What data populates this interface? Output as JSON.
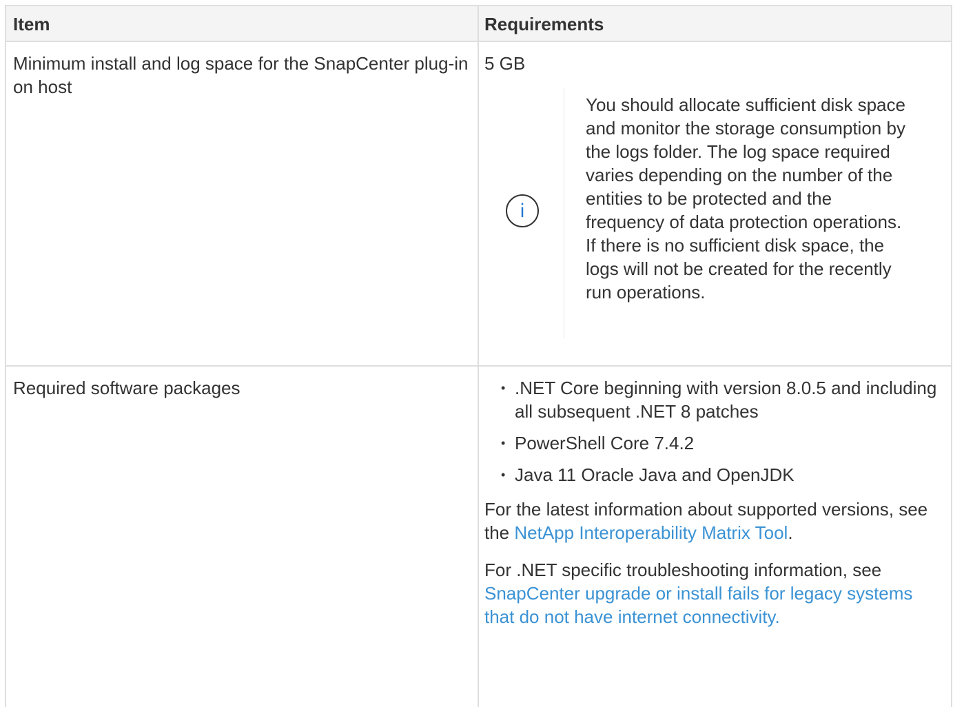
{
  "table": {
    "headers": [
      "Item",
      "Requirements"
    ],
    "rows": [
      {
        "item": "Minimum install and log space for the SnapCenter plug-in on host",
        "value": "5 GB",
        "note": {
          "icon": "info-icon",
          "text": "You should allocate sufficient disk space and monitor the storage consumption by the logs folder. The log space required varies depending on the number of the entities to be protected and the frequency of data protection operations. If there is no sufficient disk space, the logs will not be created for the recently run operations."
        }
      },
      {
        "item": "Required software packages",
        "packages": [
          ".NET Core beginning with version 8.0.5 and including all subsequent .NET 8 patches",
          "PowerShell Core 7.4.2",
          "Java 11 Oracle Java and OpenJDK"
        ],
        "para1_prefix": "For the latest information about supported versions, see the ",
        "para1_link": "NetApp Interoperability Matrix Tool",
        "para1_suffix": ".",
        "para2_prefix": "For .NET specific troubleshooting information, see ",
        "para2_link": "SnapCenter upgrade or install fails for legacy systems that do not have internet connectivity."
      }
    ]
  },
  "colors": {
    "text": "#333333",
    "link": "#3b92d4",
    "icon_accent": "#1f78d1",
    "header_bg": "#f4f4f4",
    "border": "#dedede"
  }
}
